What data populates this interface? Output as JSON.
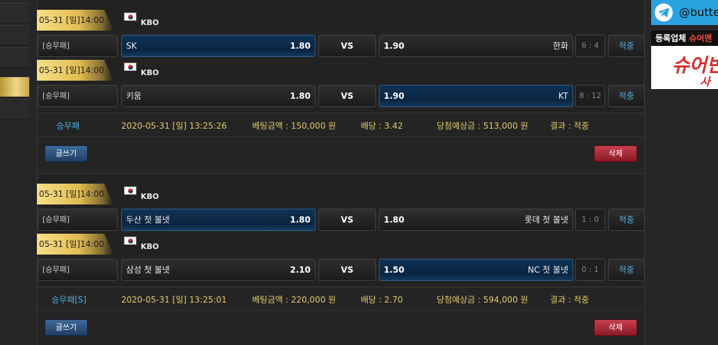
{
  "colors": {
    "odds_accent": "#4db3e6",
    "gold": "#e5c966",
    "win_selected": "#0b2540",
    "delete": "#a32230",
    "write": "#2d5282",
    "telegram": "#2aa3e0"
  },
  "icons": {
    "flag": "korea-flag-icon",
    "telegram": "telegram-icon"
  },
  "bets": [
    {
      "matches": [
        {
          "date": "05-31 [일]14:00",
          "league": "KBO",
          "type": "[승무패]",
          "home": "SK",
          "home_odds": "1.80",
          "vs": "VS",
          "away": "한화",
          "away_odds": "1.90",
          "score": "6 : 4",
          "result": "적중",
          "selected": "home"
        },
        {
          "date": "05-31 [일]14:00",
          "league": "KBO",
          "type": "[승무패]",
          "home": "키움",
          "home_odds": "1.80",
          "vs": "VS",
          "away": "KT",
          "away_odds": "1.90",
          "score": "8 : 12",
          "result": "적중",
          "selected": "away"
        }
      ],
      "summary": {
        "type": "승무패",
        "datetime": "2020-05-31 [일] 13:25:26",
        "amount": "베팅금액 : 150,000 원",
        "rate": "배당 : 3.42",
        "expected": "당첨예상금 : 513,000 원",
        "result": "결과 : 적중",
        "write_label": "글쓰기",
        "delete_label": "삭제"
      }
    },
    {
      "matches": [
        {
          "date": "05-31 [일]14:00",
          "league": "KBO",
          "type": "[승무패]",
          "home": "두산 첫 볼넷",
          "home_odds": "1.80",
          "vs": "VS",
          "away": "롯데 첫 볼넷",
          "away_odds": "1.80",
          "score": "1 : 0",
          "result": "적중",
          "selected": "home"
        },
        {
          "date": "05-31 [일]14:00",
          "league": "KBO",
          "type": "[승무패]",
          "home": "삼성 첫 볼넷",
          "home_odds": "2.10",
          "vs": "VS",
          "away": "NC 첫 볼넷",
          "away_odds": "1.50",
          "score": "0 : 1",
          "result": "적중",
          "selected": "away"
        }
      ],
      "summary": {
        "type": "승무패[S]",
        "datetime": "2020-05-31 [일] 13:25:01",
        "amount": "베팅금액 : 220,000 원",
        "rate": "배당 : 2.70",
        "expected": "당첨예상금 : 594,000 원",
        "result": "결과 : 적중",
        "write_label": "글쓰기",
        "delete_label": "삭제"
      }
    }
  ],
  "ads": {
    "telegram_handle": "@butte",
    "banner_top_white": "등록업체 ",
    "banner_top_red": "슈어맨",
    "banner_brand": "슈어빈",
    "banner_sub": "사"
  }
}
